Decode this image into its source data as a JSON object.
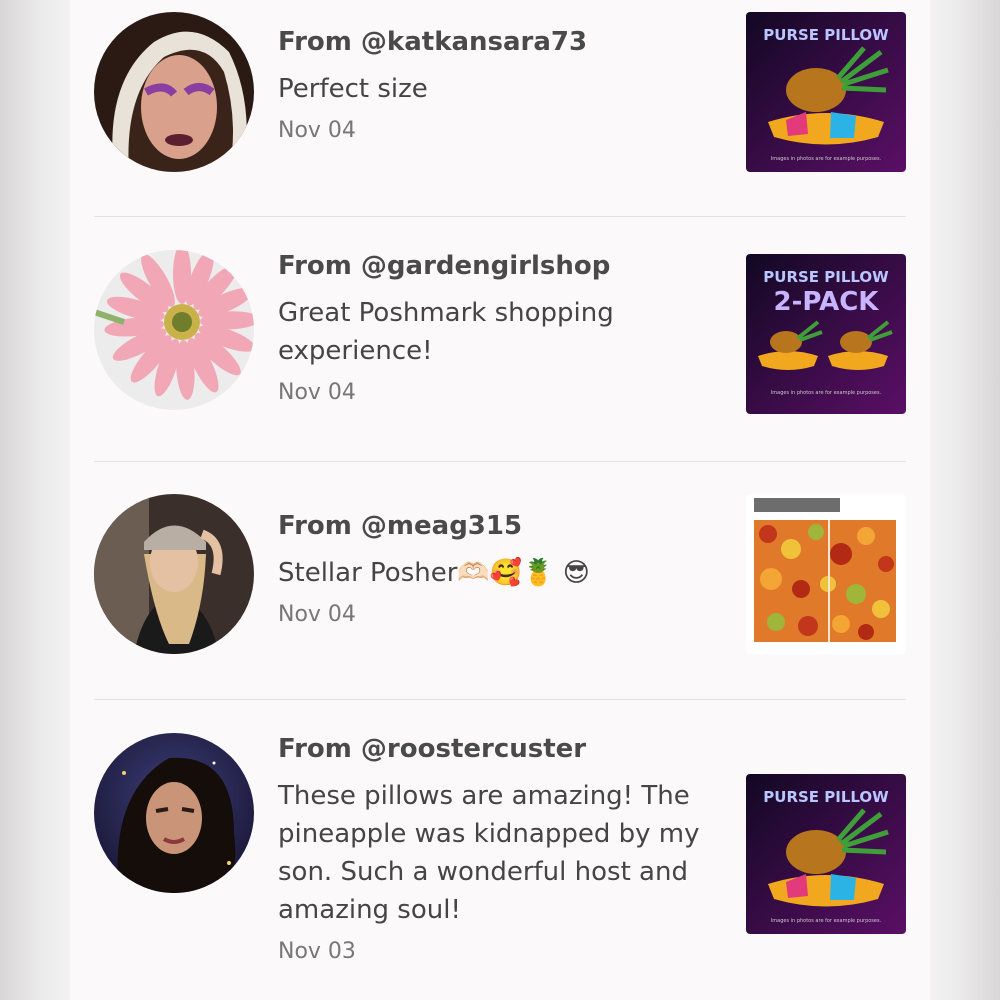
{
  "reviews": [
    {
      "from": "From @katkansara73",
      "comment": "Perfect size",
      "date": "Nov 04",
      "thumb": {
        "title": "PURSE PILLOW",
        "subtitle": "",
        "caption": "Images in photos are for example purposes."
      }
    },
    {
      "from": "From @gardengirlshop",
      "comment": "Great Poshmark shopping experience!",
      "date": "Nov 04",
      "thumb": {
        "title": "PURSE PILLOW",
        "subtitle": "2-PACK",
        "caption": "Images in photos are for example purposes."
      }
    },
    {
      "from": "From @meag315",
      "comment": "Stellar Posher🫶🏻🥰🍍 😎",
      "date": "Nov 04",
      "thumb": {
        "title": "",
        "subtitle": "",
        "caption": ""
      }
    },
    {
      "from": "From @roostercuster",
      "comment": "These pillows are amazing! The pineapple was kidnapped by my son. Such a wonderful host and amazing soul!",
      "date": "Nov 03",
      "thumb": {
        "title": "PURSE PILLOW",
        "subtitle": "",
        "caption": "Images in photos are for example purposes."
      }
    }
  ],
  "colors": {
    "panel_bg": "#fbf9fa",
    "thumb_bg_dark": "#1a0a2e",
    "thumb_bg_purple": "#4b0f5a",
    "divider": "#e3e1e2"
  },
  "icons": [
    "avatar-woman-hood",
    "avatar-pink-gerbera",
    "avatar-woman-cap",
    "avatar-woman-curly-hair",
    "pineapple-on-pillow",
    "autumn-leaves-pattern"
  ]
}
